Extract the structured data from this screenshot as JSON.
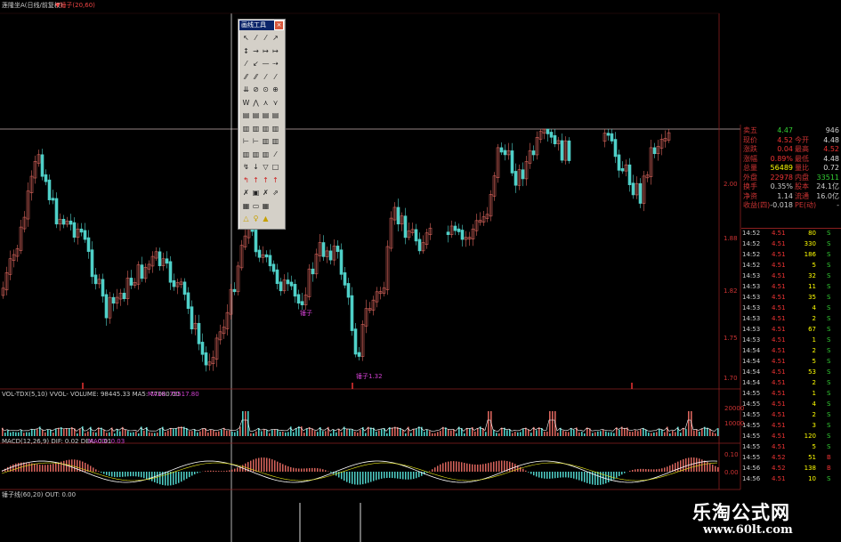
{
  "header": {
    "stock_title": "莲隆坐A(日线/前复权)",
    "signal_text": "▼锤子(20,60)"
  },
  "main_chart": {
    "price_ticks": [
      "2.00",
      "1.88",
      "1.82",
      "1.75",
      "1.70"
    ],
    "markers": [
      {
        "text": "锤子"
      },
      {
        "text": "锤子1.32"
      }
    ]
  },
  "volume_panel": {
    "header": "VOL-TDX(5,10) VVOL-  VOLUME: 98445.33  MA5: 77080.00",
    "header_highlight": "MA10: 75517.80",
    "ticks": [
      "20000",
      "10000"
    ]
  },
  "macd_panel": {
    "header": "MACD(12,26,9)  DIF: 0.02  DEA: 0.01",
    "header_highlight": "MACD: 0.03",
    "ticks": [
      "0.10",
      "0.00"
    ]
  },
  "hammer_panel": {
    "header": "锤子线(60,20)  OUT: 0.00"
  },
  "toolbox": {
    "title": "画线工具",
    "close_label": "×",
    "tools": [
      "↖",
      "⁄",
      "⁄",
      "↗",
      "↕",
      "→",
      "↦",
      "↦",
      "⁄",
      "↙",
      "—",
      "⇢",
      "⁄⁄",
      "⁄⁄",
      "⁄",
      "⁄",
      "⇊",
      "⊘",
      "⊙",
      "⊕",
      "W",
      "⋀",
      "⋏",
      "⋎",
      "▤",
      "▤",
      "▤",
      "▤",
      "▥",
      "▥",
      "▥",
      "▥",
      "⊢",
      "⊢",
      "▥",
      "▥",
      "▥",
      "▥",
      "▥",
      "⁄",
      "↯",
      "↓",
      "▽",
      "□",
      "↰",
      "↑",
      "↑",
      "↑",
      "✗",
      "▣",
      "✗",
      "⇗",
      "▦",
      "▭",
      "▦",
      "",
      "△",
      "♀",
      "▲",
      ""
    ]
  },
  "quote_panel": {
    "rows": [
      {
        "label": "卖五",
        "value": "4.47",
        "label2": "",
        "value2": "946"
      },
      {
        "label": "现价",
        "value": "4.52",
        "label2": "今开",
        "value2": "4.48"
      },
      {
        "label": "涨跌",
        "value": "0.04",
        "label2": "最高",
        "value2": "4.52"
      },
      {
        "label": "涨幅",
        "value": "0.89%",
        "label2": "最低",
        "value2": "4.48"
      },
      {
        "label": "总量",
        "value": "56489",
        "label2": "量比",
        "value2": "0.72"
      },
      {
        "label": "外盘",
        "value": "22978",
        "label2": "内盘",
        "value2": "33511"
      },
      {
        "label": "换手",
        "value": "0.35%",
        "label2": "股本",
        "value2": "24.1亿"
      },
      {
        "label": "净资",
        "value": "1.14",
        "label2": "流通",
        "value2": "16.0亿"
      },
      {
        "label": "收益(四)",
        "value": "-0.018",
        "label2": "PE(动)",
        "value2": "-"
      }
    ],
    "ticks": [
      {
        "time": "14:52",
        "price": "4.51",
        "vol": "80",
        "dir": "S"
      },
      {
        "time": "14:52",
        "price": "4.51",
        "vol": "330",
        "dir": "S"
      },
      {
        "time": "14:52",
        "price": "4.51",
        "vol": "186",
        "dir": "S"
      },
      {
        "time": "14:52",
        "price": "4.51",
        "vol": "5",
        "dir": "S"
      },
      {
        "time": "14:53",
        "price": "4.51",
        "vol": "32",
        "dir": "S"
      },
      {
        "time": "14:53",
        "price": "4.51",
        "vol": "11",
        "dir": "S"
      },
      {
        "time": "14:53",
        "price": "4.51",
        "vol": "35",
        "dir": "S"
      },
      {
        "time": "14:53",
        "price": "4.51",
        "vol": "4",
        "dir": "S"
      },
      {
        "time": "14:53",
        "price": "4.51",
        "vol": "2",
        "dir": "S"
      },
      {
        "time": "14:53",
        "price": "4.51",
        "vol": "67",
        "dir": "S"
      },
      {
        "time": "14:53",
        "price": "4.51",
        "vol": "1",
        "dir": "S"
      },
      {
        "time": "14:54",
        "price": "4.51",
        "vol": "2",
        "dir": "S"
      },
      {
        "time": "14:54",
        "price": "4.51",
        "vol": "5",
        "dir": "S"
      },
      {
        "time": "14:54",
        "price": "4.51",
        "vol": "53",
        "dir": "S"
      },
      {
        "time": "14:54",
        "price": "4.51",
        "vol": "2",
        "dir": "S"
      },
      {
        "time": "14:55",
        "price": "4.51",
        "vol": "1",
        "dir": "S"
      },
      {
        "time": "14:55",
        "price": "4.51",
        "vol": "4",
        "dir": "S"
      },
      {
        "time": "14:55",
        "price": "4.51",
        "vol": "2",
        "dir": "S"
      },
      {
        "time": "14:55",
        "price": "4.51",
        "vol": "3",
        "dir": "S"
      },
      {
        "time": "14:55",
        "price": "4.51",
        "vol": "120",
        "dir": "S"
      },
      {
        "time": "14:55",
        "price": "4.51",
        "vol": "5",
        "dir": "S"
      },
      {
        "time": "14:55",
        "price": "4.52",
        "vol": "51",
        "dir": "B"
      },
      {
        "time": "14:56",
        "price": "4.52",
        "vol": "138",
        "dir": "B"
      },
      {
        "time": "14:56",
        "price": "4.51",
        "vol": "10",
        "dir": "S"
      }
    ]
  },
  "watermark": {
    "cn": "乐淘公式网",
    "url": "www.60lt.com"
  }
}
